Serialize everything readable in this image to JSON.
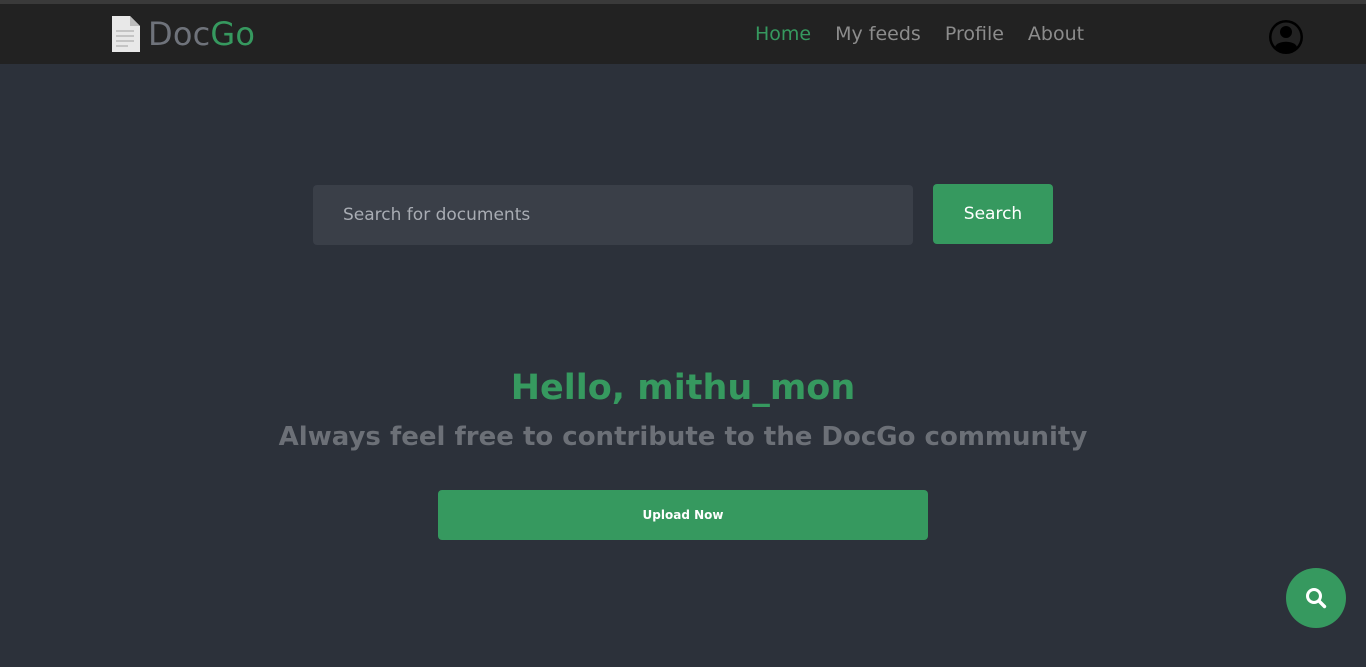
{
  "brand": {
    "part1": "Doc",
    "part2": "Go"
  },
  "nav": {
    "items": [
      {
        "label": "Home",
        "active": true
      },
      {
        "label": "My feeds",
        "active": false
      },
      {
        "label": "Profile",
        "active": false
      },
      {
        "label": "About",
        "active": false
      }
    ]
  },
  "search": {
    "placeholder": "Search for documents",
    "value": "",
    "button_label": "Search"
  },
  "hero": {
    "greeting": "Hello, mithu_mon",
    "tagline": "Always feel free to contribute to the DocGo community",
    "upload_label": "Upload Now"
  },
  "icons": {
    "logo": "document-icon",
    "account": "user-circle-icon",
    "fab": "search-icon"
  },
  "colors": {
    "accent": "#36995f",
    "background": "#2c313a",
    "navbar": "#222222",
    "muted_text": "#8c8c8c"
  }
}
